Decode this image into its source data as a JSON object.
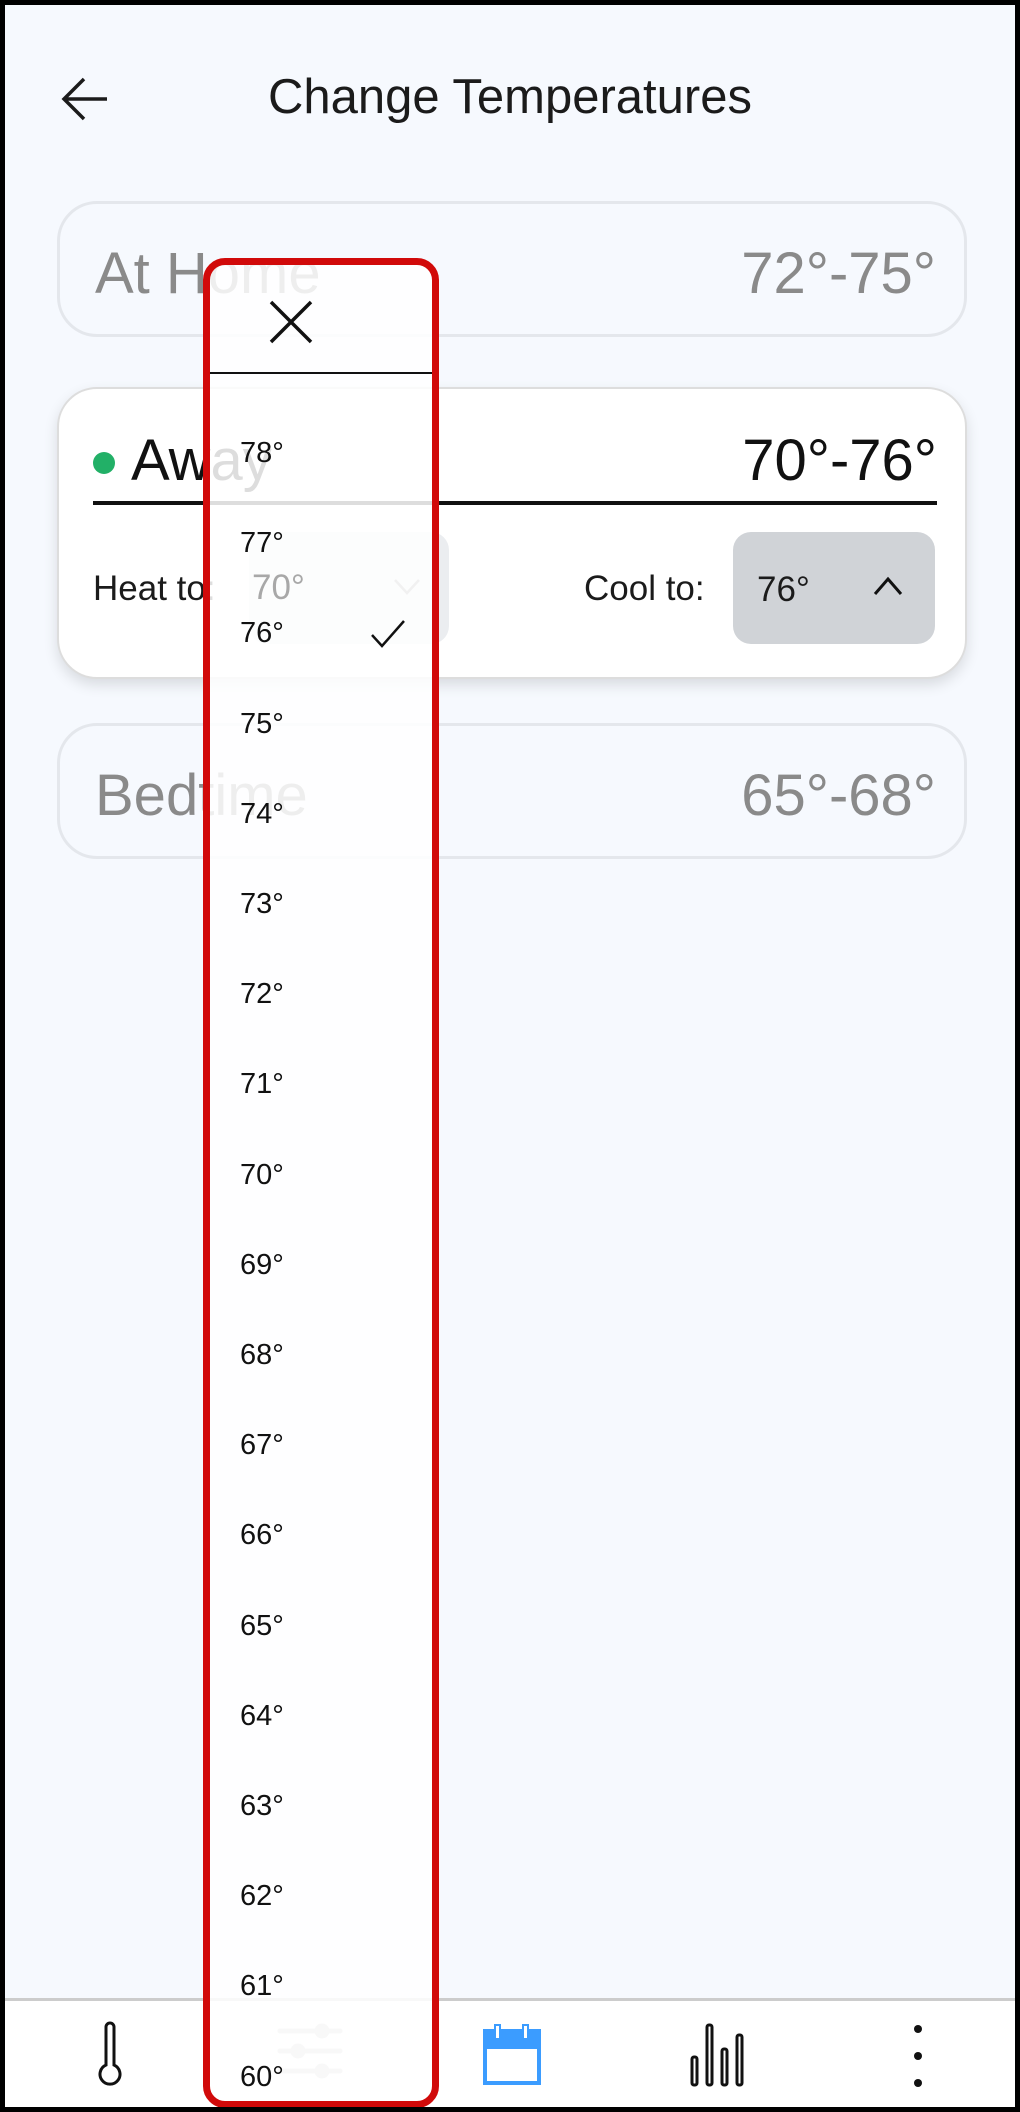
{
  "header": {
    "title": "Change Temperatures",
    "back_icon": "arrow-left-icon"
  },
  "modes": [
    {
      "name": "At Home",
      "range": "72°-75°"
    },
    {
      "name": "Away",
      "range": "70°-76°",
      "active": true,
      "status_color": "#22b067",
      "heat_label": "Heat to:",
      "heat_value": "70°",
      "cool_label": "Cool to:",
      "cool_value": "76°"
    },
    {
      "name": "Bedtime",
      "range": "65°-68°"
    }
  ],
  "dropdown": {
    "close_icon": "close-icon",
    "selected": "76°",
    "items": [
      "78°",
      "77°",
      "76°",
      "75°",
      "74°",
      "73°",
      "72°",
      "71°",
      "70°",
      "69°",
      "68°",
      "67°",
      "66°",
      "65°",
      "64°",
      "63°",
      "62°",
      "61°",
      "60°"
    ]
  },
  "nav": {
    "items": [
      "thermometer-icon",
      "sliders-icon",
      "calendar-icon",
      "bar-chart-icon",
      "more-vertical-icon"
    ],
    "active_color": "#3b9cff"
  }
}
